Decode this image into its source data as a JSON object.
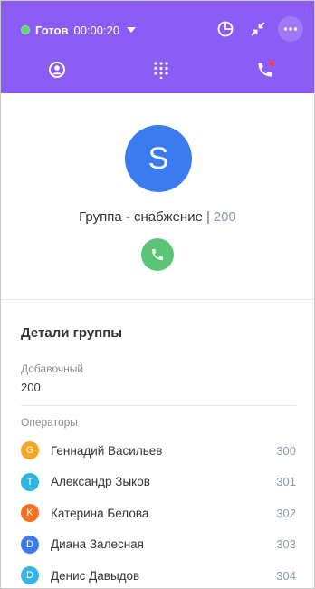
{
  "header": {
    "status_text": "Готов",
    "status_time": "00:00:20",
    "status_color": "#5ED86A",
    "bg_color": "#8B5CF6",
    "icons": [
      "pie-chart-icon",
      "minimize-icon",
      "more-icon"
    ],
    "tabs": [
      {
        "name": "contacts-tab",
        "icon": "user-circle-icon"
      },
      {
        "name": "dialpad-tab",
        "icon": "dialpad-icon"
      },
      {
        "name": "calls-tab",
        "icon": "phone-icon",
        "badge": true
      }
    ]
  },
  "contact": {
    "avatar_letter": "S",
    "avatar_color": "#3B7BF0",
    "title": "Группа - снабжение",
    "separator": "|",
    "extension": "200",
    "call_color": "#5CC477"
  },
  "details": {
    "title": "Детали группы",
    "extension_label": "Добавочный",
    "extension_value": "200",
    "operators_label": "Операторы",
    "operators": [
      {
        "initial": "G",
        "name": "Геннадий Васильев",
        "number": "300",
        "color": "#F5A623"
      },
      {
        "initial": "T",
        "name": "Александр Зыков",
        "number": "301",
        "color": "#2FB6E0"
      },
      {
        "initial": "K",
        "name": "Катерина Белова",
        "number": "302",
        "color": "#F5701F"
      },
      {
        "initial": "D",
        "name": "Диана Залесная",
        "number": "303",
        "color": "#3B7BF0"
      },
      {
        "initial": "D",
        "name": "Денис Давыдов",
        "number": "304",
        "color": "#33B5E5"
      }
    ]
  }
}
